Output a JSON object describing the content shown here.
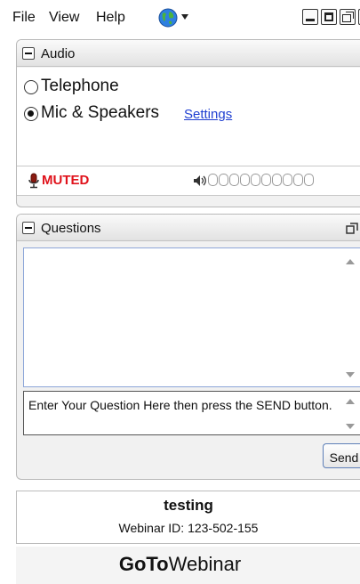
{
  "menu": {
    "file": "File",
    "view": "View",
    "help": "Help"
  },
  "audio": {
    "title": "Audio",
    "options": [
      {
        "label": "Telephone",
        "selected": false
      },
      {
        "label": "Mic & Speakers",
        "selected": true
      }
    ],
    "settings_link": "Settings",
    "mic_status": "MUTED",
    "speaker_level": 0
  },
  "questions": {
    "title": "Questions",
    "log": "",
    "input_text": "Enter Your Question Here then press the SEND button.",
    "send_label": "Send"
  },
  "webinar": {
    "name": "testing",
    "id_text": "Webinar ID: 123-502-155"
  },
  "brand": {
    "bold": "GoTo",
    "regular": "Webinar"
  },
  "colors": {
    "muted": "#e0121b",
    "link": "#1f3fd1",
    "panel": "#f1f1f1"
  }
}
